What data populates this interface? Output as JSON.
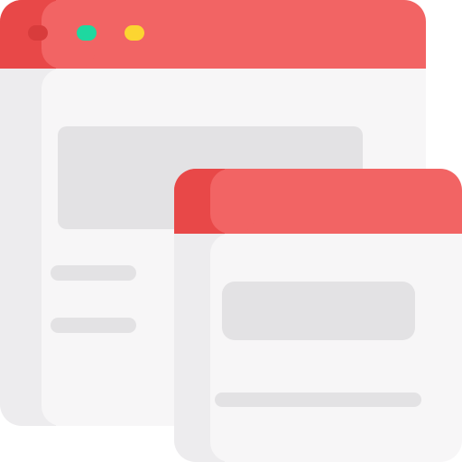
{
  "icon": {
    "name": "multiple-windows-icon",
    "back_window": {
      "controls": [
        "close-dot",
        "maximize-dot",
        "minimize-dot"
      ]
    },
    "front_window": {}
  },
  "colors": {
    "header": "#F26464",
    "header_shade": "#E84848",
    "body": "#F7F6F7",
    "body_shade": "#EDECEE",
    "placeholder": "#E3E2E4",
    "close_dot": "#D83C3C",
    "maximize_dot": "#1ED8A0",
    "minimize_dot": "#FCD531"
  }
}
